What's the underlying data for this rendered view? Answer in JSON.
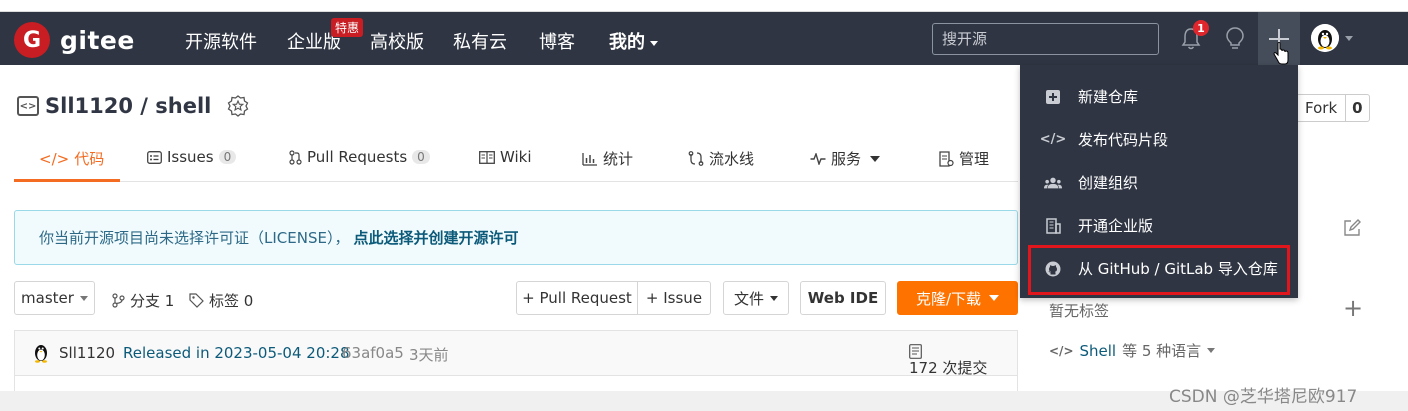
{
  "navbar": {
    "logo_letter": "G",
    "logo_text": "gitee",
    "items": [
      "开源软件",
      "企业版",
      "高校版",
      "私有云",
      "博客"
    ],
    "special_badge": "特惠",
    "mine_label": "我的",
    "search_placeholder": "搜开源",
    "notification_count": "1",
    "colors": {
      "bg": "#2f3542",
      "brand": "#c71d23"
    }
  },
  "repo": {
    "title": "Sll1120 / shell",
    "fork_label": "Fork",
    "fork_count": "0"
  },
  "tabs": [
    {
      "label": "代码",
      "icon": "code-icon"
    },
    {
      "label": "Issues",
      "count": "0",
      "icon": "issues-icon"
    },
    {
      "label": "Pull Requests",
      "count": "0",
      "icon": "pull-request-icon"
    },
    {
      "label": "Wiki",
      "icon": "wiki-icon"
    },
    {
      "label": "统计",
      "icon": "stats-icon"
    },
    {
      "label": "流水线",
      "icon": "pipeline-icon"
    },
    {
      "label": "服务",
      "icon": "service-icon"
    },
    {
      "label": "管理",
      "icon": "manage-icon"
    }
  ],
  "license": {
    "text": "你当前开源项目尚未选择许可证（LICENSE），",
    "link": "点此选择并创建开源许可"
  },
  "toolbar": {
    "branch": "master",
    "branches": "分支 1",
    "tags": "标签 0",
    "pull_request": "+ Pull Request",
    "issue": "+ Issue",
    "file": "文件",
    "web_ide": "Web IDE",
    "clone": "克隆/下载"
  },
  "commit": {
    "author": "Sll1120",
    "message": "Released in 2023-05-04 20:28",
    "hash": "63af0a5",
    "time": "3天前",
    "commits": "172 次提交"
  },
  "sidebar": {
    "tags_none": "暂无标签",
    "lang_name": "Shell",
    "lang_rest": "等 5 种语言"
  },
  "dropdown": {
    "items": [
      {
        "label": "新建仓库",
        "icon": "new-repo-icon"
      },
      {
        "label": "发布代码片段",
        "icon": "code-snippet-icon"
      },
      {
        "label": "创建组织",
        "icon": "organization-icon"
      },
      {
        "label": "开通企业版",
        "icon": "enterprise-icon"
      },
      {
        "label": "从 GitHub / GitLab 导入仓库",
        "icon": "github-icon"
      }
    ]
  },
  "watermark": "CSDN @芝华塔尼欧917"
}
